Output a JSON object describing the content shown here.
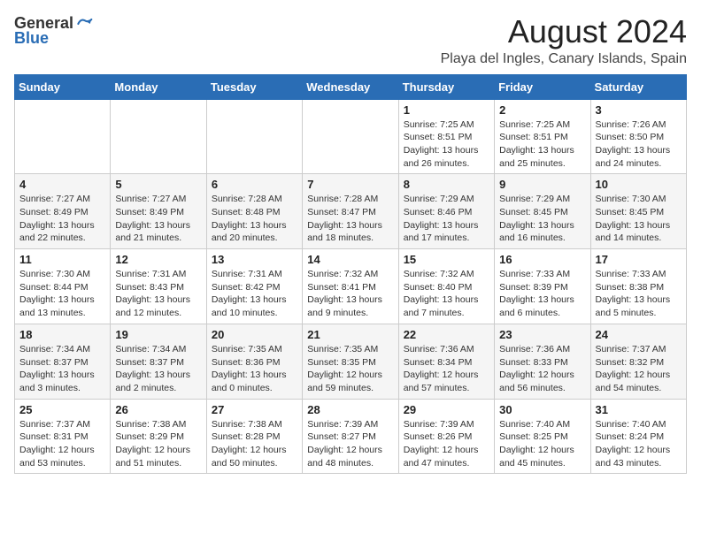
{
  "logo": {
    "general": "General",
    "blue": "Blue"
  },
  "header": {
    "title": "August 2024",
    "subtitle": "Playa del Ingles, Canary Islands, Spain"
  },
  "weekdays": [
    "Sunday",
    "Monday",
    "Tuesday",
    "Wednesday",
    "Thursday",
    "Friday",
    "Saturday"
  ],
  "weeks": [
    [
      {
        "day": "",
        "info": ""
      },
      {
        "day": "",
        "info": ""
      },
      {
        "day": "",
        "info": ""
      },
      {
        "day": "",
        "info": ""
      },
      {
        "day": "1",
        "info": "Sunrise: 7:25 AM\nSunset: 8:51 PM\nDaylight: 13 hours and 26 minutes."
      },
      {
        "day": "2",
        "info": "Sunrise: 7:25 AM\nSunset: 8:51 PM\nDaylight: 13 hours and 25 minutes."
      },
      {
        "day": "3",
        "info": "Sunrise: 7:26 AM\nSunset: 8:50 PM\nDaylight: 13 hours and 24 minutes."
      }
    ],
    [
      {
        "day": "4",
        "info": "Sunrise: 7:27 AM\nSunset: 8:49 PM\nDaylight: 13 hours and 22 minutes."
      },
      {
        "day": "5",
        "info": "Sunrise: 7:27 AM\nSunset: 8:49 PM\nDaylight: 13 hours and 21 minutes."
      },
      {
        "day": "6",
        "info": "Sunrise: 7:28 AM\nSunset: 8:48 PM\nDaylight: 13 hours and 20 minutes."
      },
      {
        "day": "7",
        "info": "Sunrise: 7:28 AM\nSunset: 8:47 PM\nDaylight: 13 hours and 18 minutes."
      },
      {
        "day": "8",
        "info": "Sunrise: 7:29 AM\nSunset: 8:46 PM\nDaylight: 13 hours and 17 minutes."
      },
      {
        "day": "9",
        "info": "Sunrise: 7:29 AM\nSunset: 8:45 PM\nDaylight: 13 hours and 16 minutes."
      },
      {
        "day": "10",
        "info": "Sunrise: 7:30 AM\nSunset: 8:45 PM\nDaylight: 13 hours and 14 minutes."
      }
    ],
    [
      {
        "day": "11",
        "info": "Sunrise: 7:30 AM\nSunset: 8:44 PM\nDaylight: 13 hours and 13 minutes."
      },
      {
        "day": "12",
        "info": "Sunrise: 7:31 AM\nSunset: 8:43 PM\nDaylight: 13 hours and 12 minutes."
      },
      {
        "day": "13",
        "info": "Sunrise: 7:31 AM\nSunset: 8:42 PM\nDaylight: 13 hours and 10 minutes."
      },
      {
        "day": "14",
        "info": "Sunrise: 7:32 AM\nSunset: 8:41 PM\nDaylight: 13 hours and 9 minutes."
      },
      {
        "day": "15",
        "info": "Sunrise: 7:32 AM\nSunset: 8:40 PM\nDaylight: 13 hours and 7 minutes."
      },
      {
        "day": "16",
        "info": "Sunrise: 7:33 AM\nSunset: 8:39 PM\nDaylight: 13 hours and 6 minutes."
      },
      {
        "day": "17",
        "info": "Sunrise: 7:33 AM\nSunset: 8:38 PM\nDaylight: 13 hours and 5 minutes."
      }
    ],
    [
      {
        "day": "18",
        "info": "Sunrise: 7:34 AM\nSunset: 8:37 PM\nDaylight: 13 hours and 3 minutes."
      },
      {
        "day": "19",
        "info": "Sunrise: 7:34 AM\nSunset: 8:37 PM\nDaylight: 13 hours and 2 minutes."
      },
      {
        "day": "20",
        "info": "Sunrise: 7:35 AM\nSunset: 8:36 PM\nDaylight: 13 hours and 0 minutes."
      },
      {
        "day": "21",
        "info": "Sunrise: 7:35 AM\nSunset: 8:35 PM\nDaylight: 12 hours and 59 minutes."
      },
      {
        "day": "22",
        "info": "Sunrise: 7:36 AM\nSunset: 8:34 PM\nDaylight: 12 hours and 57 minutes."
      },
      {
        "day": "23",
        "info": "Sunrise: 7:36 AM\nSunset: 8:33 PM\nDaylight: 12 hours and 56 minutes."
      },
      {
        "day": "24",
        "info": "Sunrise: 7:37 AM\nSunset: 8:32 PM\nDaylight: 12 hours and 54 minutes."
      }
    ],
    [
      {
        "day": "25",
        "info": "Sunrise: 7:37 AM\nSunset: 8:31 PM\nDaylight: 12 hours and 53 minutes."
      },
      {
        "day": "26",
        "info": "Sunrise: 7:38 AM\nSunset: 8:29 PM\nDaylight: 12 hours and 51 minutes."
      },
      {
        "day": "27",
        "info": "Sunrise: 7:38 AM\nSunset: 8:28 PM\nDaylight: 12 hours and 50 minutes."
      },
      {
        "day": "28",
        "info": "Sunrise: 7:39 AM\nSunset: 8:27 PM\nDaylight: 12 hours and 48 minutes."
      },
      {
        "day": "29",
        "info": "Sunrise: 7:39 AM\nSunset: 8:26 PM\nDaylight: 12 hours and 47 minutes."
      },
      {
        "day": "30",
        "info": "Sunrise: 7:40 AM\nSunset: 8:25 PM\nDaylight: 12 hours and 45 minutes."
      },
      {
        "day": "31",
        "info": "Sunrise: 7:40 AM\nSunset: 8:24 PM\nDaylight: 12 hours and 43 minutes."
      }
    ]
  ]
}
